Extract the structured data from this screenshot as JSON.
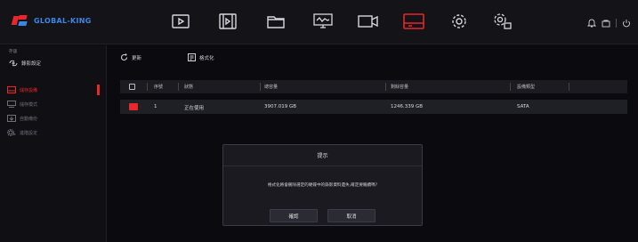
{
  "brand": {
    "name": "GLOBAL-KING",
    "accent": "#e8262b",
    "text_color": "#3c86e6"
  },
  "topnav": {
    "items": [
      {
        "name": "playback-icon",
        "active": false
      },
      {
        "name": "video-clip-icon",
        "active": false
      },
      {
        "name": "folder-icon",
        "active": false
      },
      {
        "name": "network-icon",
        "active": false
      },
      {
        "name": "camera-icon",
        "active": false
      },
      {
        "name": "storage-icon",
        "active": true
      },
      {
        "name": "settings-gear-icon",
        "active": false
      },
      {
        "name": "advanced-settings-icon",
        "active": false
      }
    ],
    "right": [
      "bell-icon",
      "lock-icon",
      "power-icon"
    ]
  },
  "sidebar": {
    "header": "存儲",
    "section": "錄影設定",
    "items": [
      {
        "label": "儲存設備",
        "icon": "storage-device-icon",
        "active": true
      },
      {
        "label": "儲存模式",
        "icon": "storage-mode-icon",
        "active": false
      },
      {
        "label": "自動備份",
        "icon": "auto-backup-icon",
        "active": false
      },
      {
        "label": "進階設定",
        "icon": "advanced-icon",
        "active": false
      }
    ]
  },
  "toolbar": {
    "refresh_label": "更新",
    "format_label": "格式化"
  },
  "table": {
    "headers": {
      "index": "序號",
      "status": "狀態",
      "total": "總容量",
      "free": "剩餘容量",
      "type": "設備類型"
    },
    "rows": [
      {
        "index": "1",
        "status": "正在使用",
        "total": "3907.019 GB",
        "free": "1246.339 GB",
        "type": "SATA"
      }
    ]
  },
  "dialog": {
    "title": "提示",
    "message": "格式化將會刪除選定的硬碟中的錄影資料遺失,確定要繼續嗎?",
    "ok_label": "確認",
    "cancel_label": "取消"
  }
}
